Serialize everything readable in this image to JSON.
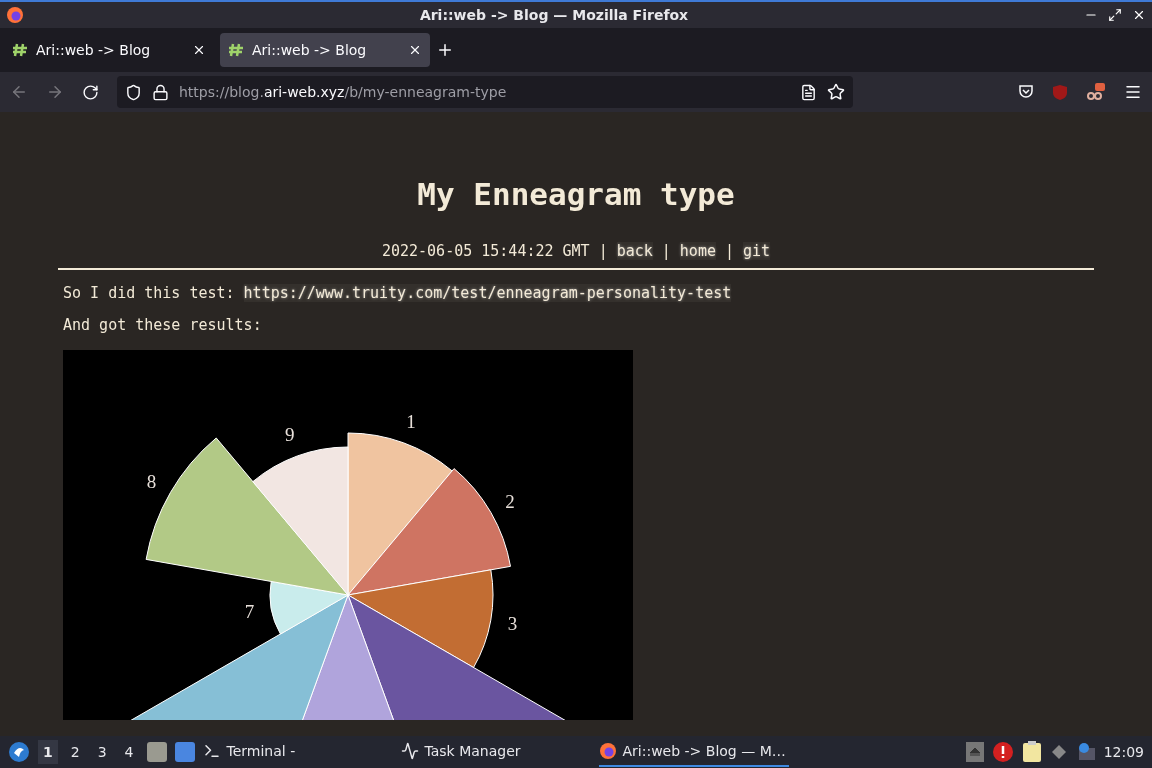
{
  "window": {
    "title": "Ari::web -> Blog — Mozilla Firefox"
  },
  "tabs": [
    {
      "label": "Ari::web -> Blog",
      "selected": false
    },
    {
      "label": "Ari::web -> Blog",
      "selected": true
    }
  ],
  "address": {
    "scheme": "https://",
    "subdomain": "blog.",
    "domain": "ari-web.xyz",
    "path": "/b/my-enneagram-type"
  },
  "post": {
    "title": "My Enneagram type",
    "meta": [
      {
        "kind": "text",
        "text": "2022-06-05 15:44:22 GMT"
      },
      {
        "kind": "text",
        "text": "|"
      },
      {
        "kind": "link",
        "text": "back"
      },
      {
        "kind": "text",
        "text": "|"
      },
      {
        "kind": "link",
        "text": "home"
      },
      {
        "kind": "text",
        "text": "|"
      },
      {
        "kind": "link",
        "text": "git"
      }
    ],
    "paragraphs": [
      [
        {
          "kind": "text",
          "text": "So I did this test:"
        },
        {
          "kind": "link",
          "text": "https://www.truity.com/test/enneagram-personality-test"
        }
      ],
      [
        {
          "kind": "text",
          "text": "And got these results:"
        }
      ]
    ],
    "chart": {
      "sectors": [
        {
          "label": "1",
          "color": "#f0c4a0"
        },
        {
          "label": "2",
          "color": "#cf7462"
        },
        {
          "label": "3",
          "color": "#c26d33"
        },
        {
          "color": "#6a55a0"
        },
        {
          "color": "#b0a4dc"
        },
        {
          "color": "#86bfd6"
        },
        {
          "label": "7",
          "color": "#c9ecec"
        },
        {
          "label": "8",
          "color": "#b2c986"
        },
        {
          "label": "9",
          "color": "#f2e6e2"
        }
      ]
    }
  },
  "taskbar": {
    "workspaces": [
      {
        "label": "1",
        "selected": true
      },
      {
        "label": "2",
        "selected": false
      },
      {
        "label": "3",
        "selected": false
      },
      {
        "label": "4",
        "selected": false
      }
    ],
    "tasks": [
      {
        "kind": "terminal",
        "label": "Terminal -",
        "selected": false
      },
      {
        "kind": "monitor",
        "label": "Task Manager",
        "selected": false
      },
      {
        "kind": "browser",
        "label": "Ari::web -> Blog — M…",
        "selected": true
      }
    ],
    "clock": "12:09"
  }
}
